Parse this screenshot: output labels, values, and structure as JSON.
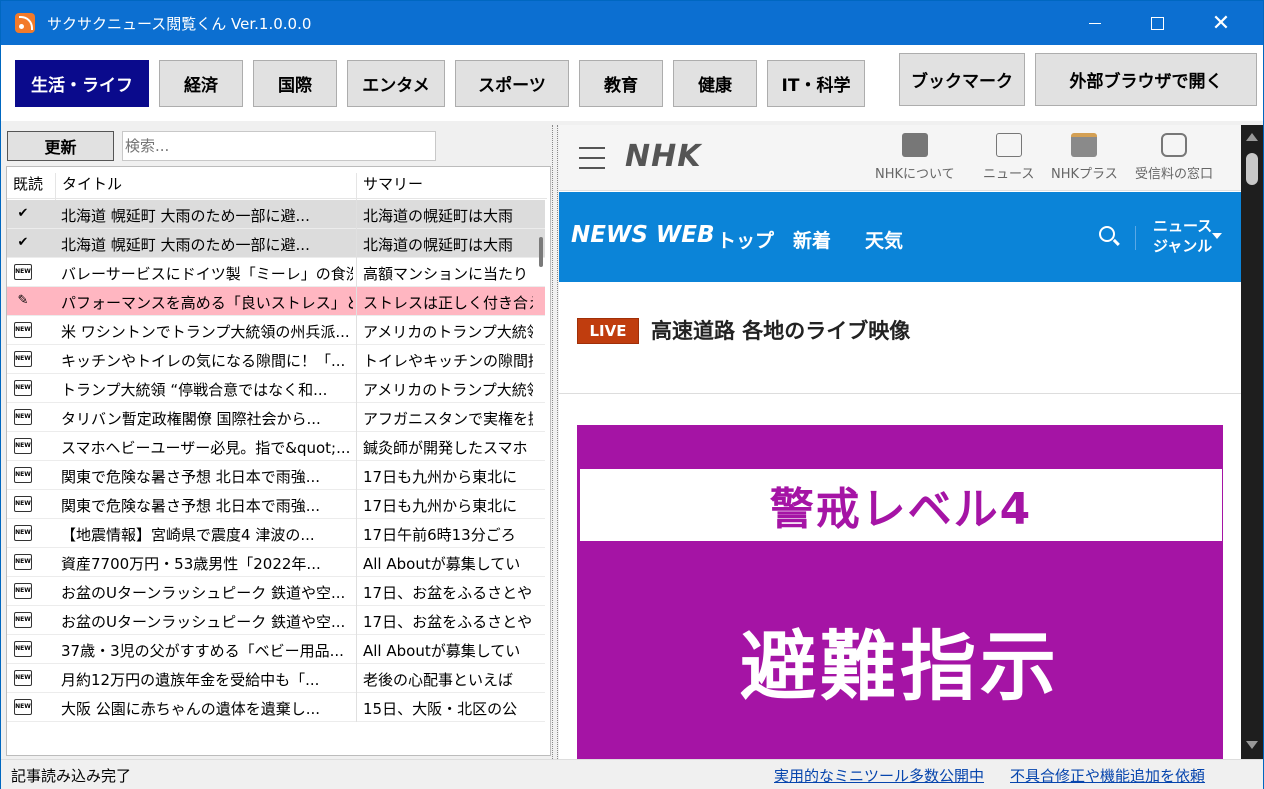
{
  "window": {
    "title": "サクサクニュース閲覧くん Ver.1.0.0.0"
  },
  "categories": [
    {
      "label": "生活・ライフ",
      "active": true
    },
    {
      "label": "経済",
      "active": false
    },
    {
      "label": "国際",
      "active": false
    },
    {
      "label": "エンタメ",
      "active": false
    },
    {
      "label": "スポーツ",
      "active": false
    },
    {
      "label": "教育",
      "active": false
    },
    {
      "label": "健康",
      "active": false
    },
    {
      "label": "IT・科学",
      "active": false
    }
  ],
  "toolbar": {
    "bookmark_label": "ブックマーク",
    "external_label": "外部ブラウザで開く"
  },
  "list_panel": {
    "refresh_label": "更新",
    "search_placeholder": "検索...",
    "columns": {
      "read": "既読",
      "title": "タイトル",
      "summary": "サマリー"
    },
    "rows": [
      {
        "status": "read",
        "title": "北海道 幌延町 大雨のため一部に避...",
        "summary": "北海道の幌延町は大雨"
      },
      {
        "status": "read",
        "title": "北海道 幌延町 大雨のため一部に避...",
        "summary": "北海道の幌延町は大雨"
      },
      {
        "status": "new",
        "title": "バレーサービスにドイツ製「ミーレ」の食洗...",
        "summary": "高額マンションに当たり"
      },
      {
        "status": "bookmark",
        "title": "パフォーマンスを高める「良いストレス」と...",
        "summary": "ストレスは正しく付き合え"
      },
      {
        "status": "new",
        "title": "米 ワシントンでトランプ大統領の州兵派...",
        "summary": "アメリカのトランプ大統領"
      },
      {
        "status": "new",
        "title": "キッチンやトイレの気になる隙間に！「...",
        "summary": "トイレやキッチンの隙間掃"
      },
      {
        "status": "new",
        "title": "トランプ大統領 “停戦合意ではなく和...",
        "summary": "アメリカのトランプ大統領"
      },
      {
        "status": "new",
        "title": "タリバン暫定政権閣僚 国際社会から...",
        "summary": "アフガニスタンで実権を握"
      },
      {
        "status": "new",
        "title": "スマホヘビーユーザー必見。指で&quot;...",
        "summary": "鍼灸師が開発したスマホ"
      },
      {
        "status": "new",
        "title": "関東で危険な暑さ予想 北日本で雨強...",
        "summary": "17日も九州から東北に"
      },
      {
        "status": "new",
        "title": "関東で危険な暑さ予想 北日本で雨強...",
        "summary": "17日も九州から東北に"
      },
      {
        "status": "new",
        "title": "【地震情報】宮崎県で震度4 津波の...",
        "summary": "17日午前6時13分ごろ"
      },
      {
        "status": "new",
        "title": "資産7700万円・53歳男性「2022年...",
        "summary": "All Aboutが募集してい"
      },
      {
        "status": "new",
        "title": "お盆のUターンラッシュピーク 鉄道や空...",
        "summary": "17日、お盆をふるさとや"
      },
      {
        "status": "new",
        "title": "お盆のUターンラッシュピーク 鉄道や空...",
        "summary": "17日、お盆をふるさとや"
      },
      {
        "status": "new",
        "title": "37歳・3児の父がすすめる「ベビー用品...",
        "summary": "All Aboutが募集してい"
      },
      {
        "status": "new",
        "title": "月約12万円の遺族年金を受給中も「...",
        "summary": "老後の心配事といえば"
      },
      {
        "status": "new",
        "title": "大阪 公園に赤ちゃんの遺体を遺棄し...",
        "summary": "15日、大阪・北区の公"
      }
    ]
  },
  "browser": {
    "nhk_logo": "NHK",
    "header_icons": [
      {
        "label": "NHKについて"
      },
      {
        "label": "ニュース"
      },
      {
        "label": "NHKプラス"
      },
      {
        "label": "受信料の窓口"
      }
    ],
    "newsweb_logo": "NEWS WEB",
    "nav": {
      "top": "トップ",
      "latest": "新着",
      "weather": "天気",
      "genre_line1": "ニュース",
      "genre_line2": "ジャンル"
    },
    "live_badge": "LIVE",
    "live_title": "高速道路 各地のライブ映像",
    "alert": {
      "level_text": "警戒レベル4",
      "main_text": "避難指示",
      "color": "#a514a5"
    }
  },
  "statusbar": {
    "message": "記事読み込み完了",
    "link1": "実用的なミニツール多数公開中",
    "link2": "不具合修正や機能追加を依頼"
  }
}
